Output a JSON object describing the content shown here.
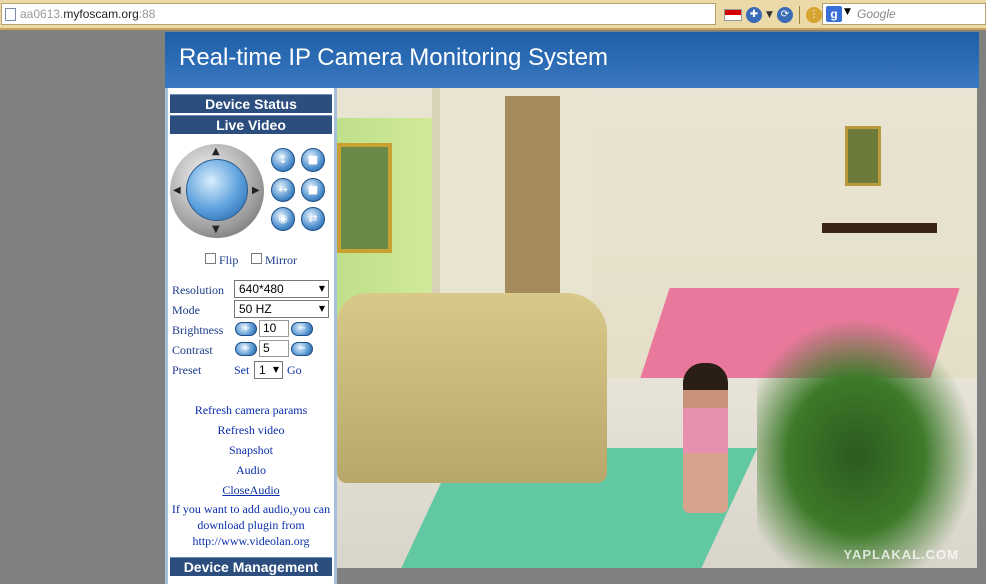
{
  "browser": {
    "url_host_prefix": "aa0613.",
    "url_host": "myfoscam.org",
    "url_port": ":88",
    "search_placeholder": "Google"
  },
  "header": {
    "title": "Real-time IP Camera Monitoring System"
  },
  "nav": {
    "device_status": "Device Status",
    "live_video": "Live Video",
    "device_management": "Device Management"
  },
  "controls": {
    "flip_label": "Flip",
    "mirror_label": "Mirror",
    "resolution_label": "Resolution",
    "resolution_value": "640*480",
    "mode_label": "Mode",
    "mode_value": "50 HZ",
    "brightness_label": "Brightness",
    "brightness_value": "10",
    "contrast_label": "Contrast",
    "contrast_value": "5",
    "preset_label": "Preset",
    "preset_set": "Set",
    "preset_value": "1",
    "preset_go": "Go"
  },
  "links": {
    "refresh_params": "Refresh camera params",
    "refresh_video": "Refresh video",
    "snapshot": "Snapshot",
    "audio": "Audio",
    "close_audio": "CloseAudio",
    "audio_note_1": "If you want to add audio,you can",
    "audio_note_2": "download plugin from",
    "audio_note_3": "http://www.videolan.org"
  },
  "video": {
    "watermark": "YAPLAKAL.COM"
  }
}
